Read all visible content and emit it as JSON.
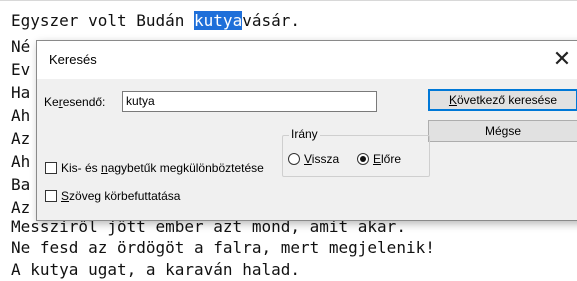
{
  "editor": {
    "lines": [
      {
        "before": "Egyszer volt Budán ",
        "highlight": "kutya",
        "after": "vásár."
      },
      {
        "text": "Né"
      },
      {
        "text": "Ev"
      },
      {
        "text": "Ha"
      },
      {
        "text": "Ah"
      },
      {
        "text": "Az"
      },
      {
        "text": "Ah"
      },
      {
        "text": "Ba"
      },
      {
        "text": "Az"
      },
      {
        "text": "Messziről jött ember azt mond, amit akar."
      },
      {
        "text": "Ne fesd az ördögöt a falra, mert megjelenik!"
      },
      {
        "text": "A kutya ugat, a karaván halad."
      }
    ]
  },
  "dialog": {
    "title": "Keresés",
    "close_glyph": "✕",
    "search": {
      "label_pre": "Ke",
      "label_u": "r",
      "label_post": "esendő:",
      "value": "kutya"
    },
    "buttons": {
      "find_next": {
        "u": "K",
        "rest": "övetkező keresése"
      },
      "cancel": "Mégse"
    },
    "direction": {
      "title": "Irány",
      "up": {
        "u": "V",
        "rest": "issza"
      },
      "down": {
        "u": "E",
        "rest": "lőre"
      },
      "selected": "down"
    },
    "options": {
      "match_case": {
        "pre": "Kis- és ",
        "u": "n",
        "post": "agybetűk megkülönböztetése",
        "checked": false
      },
      "wrap": {
        "pre": "",
        "u": "S",
        "post": "zöveg körbefuttatása",
        "checked": false
      }
    }
  }
}
